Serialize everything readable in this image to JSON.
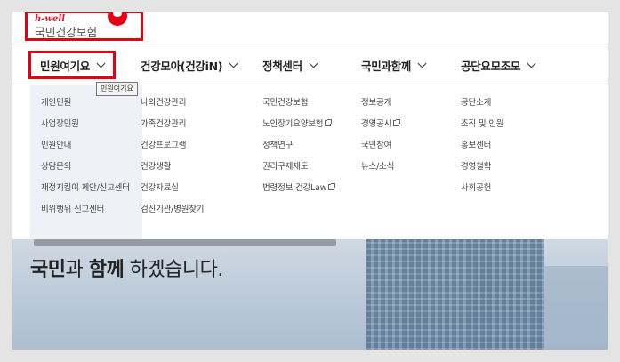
{
  "logo": {
    "sub": "h-well",
    "main": "국민건강보험"
  },
  "nav": {
    "items": [
      {
        "label": "민원여기요"
      },
      {
        "label": "건강모아(건강iN)"
      },
      {
        "label": "정책센터"
      },
      {
        "label": "국민과함께"
      },
      {
        "label": "공단요모조모"
      }
    ]
  },
  "tooltip": "민원여기요",
  "submenu": {
    "col1": [
      "개인민원",
      "사업장민원",
      "민원안내",
      "상담문의",
      "재정지킴이 제안/신고센터",
      "비위행위 신고센터"
    ],
    "col2": [
      "나의건강관리",
      "가족건강관리",
      "건강프로그램",
      "건강생활",
      "건강자료실",
      "검진기관/병원찾기"
    ],
    "col3": [
      "국민건강보험",
      "노인장기요양보험",
      "정책연구",
      "권리구제제도",
      "법령정보 건강Law"
    ],
    "col4": [
      "정보공개",
      "경영공시",
      "국민참여",
      "뉴스/소식"
    ],
    "col5": [
      "공단소개",
      "조직 및 인원",
      "홍보센터",
      "경영철학",
      "사회공헌"
    ]
  },
  "hero": {
    "headline_1": "국민",
    "headline_2": "과 ",
    "headline_3": "함께",
    "headline_4": " 하겠습니다."
  },
  "colors": {
    "highlight": "#e60012",
    "submenu_bg": "#eef2f8"
  }
}
